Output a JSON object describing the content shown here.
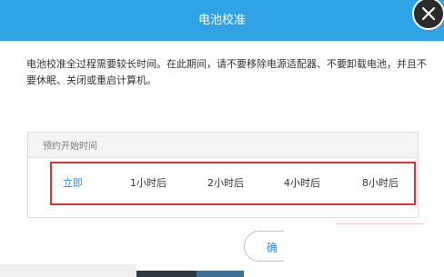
{
  "dialog": {
    "title": "电池校准",
    "description": "电池校准全过程需要较长时间。在此期间，请不要移除电源适配器、不要卸载电池，并且不要休眠、关闭或重启计算机。"
  },
  "schedule": {
    "header": "预约开始时间",
    "options": [
      "立即",
      "1小时后",
      "2小时后",
      "4小时后",
      "8小时后"
    ],
    "selected": "立即"
  },
  "footer": {
    "start_label": "确"
  },
  "colors": {
    "header_bg": "#2fa3e6",
    "accent": "#2a8ad6",
    "highlight_border": "#e0303a"
  }
}
